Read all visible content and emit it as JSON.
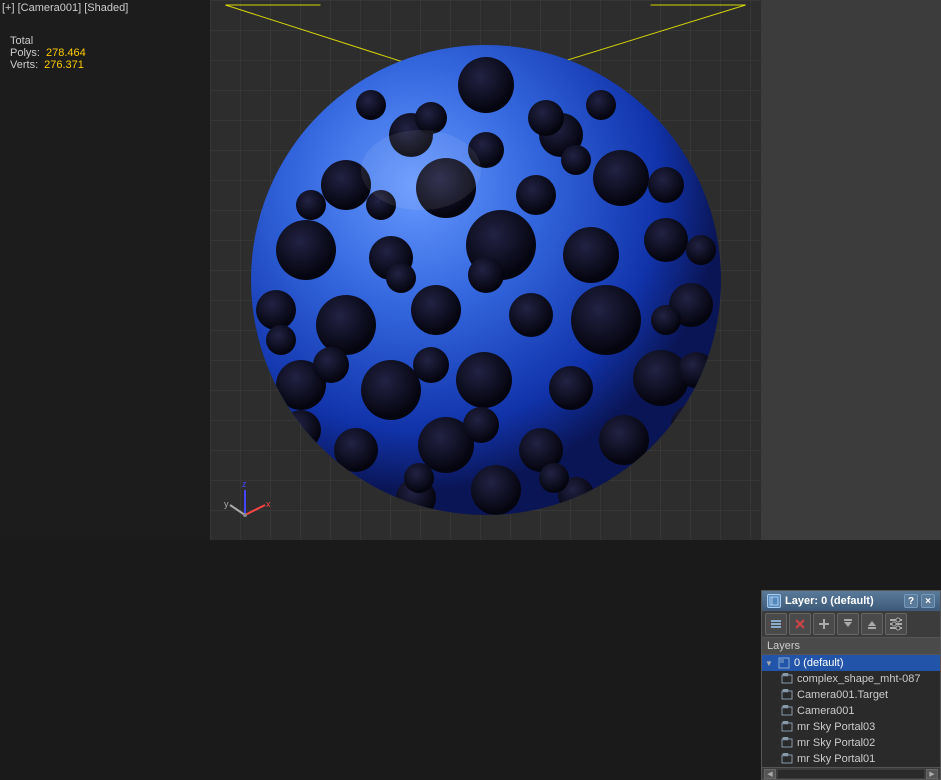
{
  "header": {
    "viewport_label": "[+] [Camera001] [Shaded]"
  },
  "stats": {
    "total_label": "Total",
    "polys_label": "Polys:",
    "polys_value": "278.464",
    "verts_label": "Verts:",
    "verts_value": "276.371"
  },
  "dialog": {
    "title": "Layer: 0 (default)",
    "help_btn": "?",
    "close_btn": "×"
  },
  "toolbar": {
    "btn1_icon": "≡",
    "btn2_icon": "×",
    "btn3_icon": "+",
    "btn4_icon": "↓",
    "btn5_icon": "↑",
    "btn6_icon": "≡"
  },
  "layers_section": {
    "label": "Layers"
  },
  "layer_items": [
    {
      "id": "0",
      "name": "0 (default)",
      "indent": 0,
      "selected": true,
      "expanded": true
    },
    {
      "id": "1",
      "name": "complex_shape_mht-087",
      "indent": 1,
      "selected": false,
      "expanded": false
    },
    {
      "id": "2",
      "name": "Camera001.Target",
      "indent": 1,
      "selected": false,
      "expanded": false
    },
    {
      "id": "3",
      "name": "Camera001",
      "indent": 1,
      "selected": false,
      "expanded": false
    },
    {
      "id": "4",
      "name": "mr Sky Portal03",
      "indent": 1,
      "selected": false,
      "expanded": false
    },
    {
      "id": "5",
      "name": "mr Sky Portal02",
      "indent": 1,
      "selected": false,
      "expanded": false
    },
    {
      "id": "6",
      "name": "mr Sky Portal01",
      "indent": 1,
      "selected": false,
      "expanded": false
    }
  ],
  "axes": {
    "x_color": "#ff4444",
    "y_color": "#44ff44",
    "z_color": "#4444ff"
  }
}
